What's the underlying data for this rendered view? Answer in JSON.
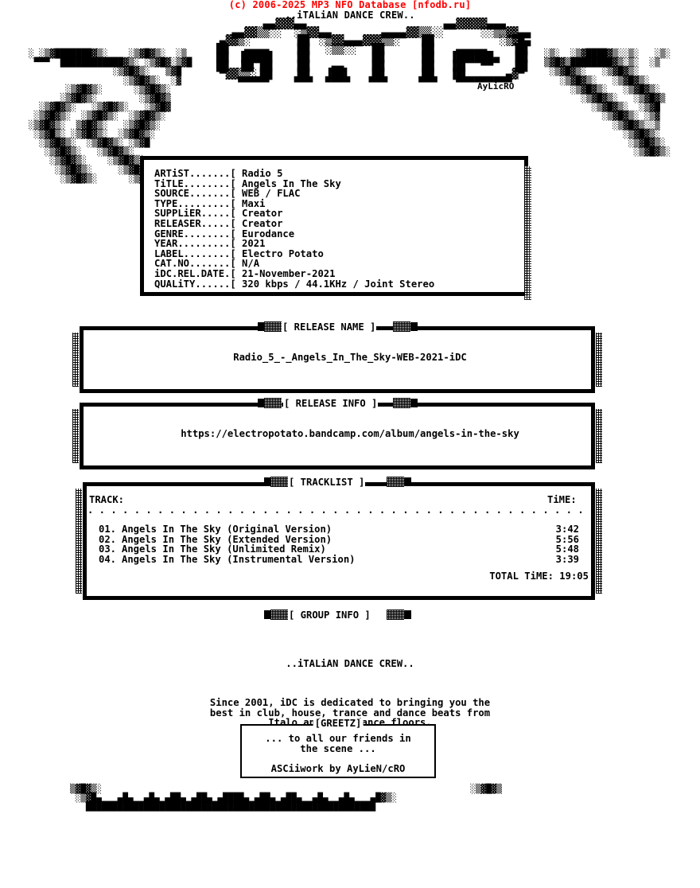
{
  "header": {
    "db_credit": "(c) 2006-2025 MP3 NFO Database [nfodb.ru]",
    "crew_tagline": "..iTALiAN DANCE CREW..",
    "credit_color": "#ff0000",
    "text_color": "#000000",
    "background_color": "#ffffff"
  },
  "logo": {
    "name": "idc-ascii-logo",
    "text": "iDC",
    "signature": "AyLicRO",
    "ascii": "        ▄▄▓▓▓▄▄                      ▄▄▓▓▓▓▓▄▄▄\n   ▄▄▓▓▒▒░░  ░▒▓▓▄▄        ▄▄▄▄▓▓▒▒░░      ░░▒▒▓▓▄▄\n ▄▓▓▒░       ▐█▌ ░▒▓▓▄▄▄▓▓▓▒▒░   ▐█▌          ░▒▓█▄\n▐█▌  ▄▄▄▄    ▐█▌  ░▒▒░░  ▐█▌     ▐█▌   ▄▄▄▄▄    ▐█▌\n▐█▌ ▐████▌   ▐█▌         ▐█▌     ▐█▌  ▐██████▄  ▐█▌\n▐█▌ ▐█▌▐█▌   ▐█▌   ▄▄    ▐█▌     ▐█▌  ▐█▌  ▀▀   ▐█▌\n ▀▓▓▒▒░▐█▌   ▐█▌  ▐██▌   ▐█▌     ▐█▌  ▐█▌      ▄▓▀\n    ▀▀▀▀▀    ▀▀▀  ▀▀▀▀   ▀▀▀     ▀▀▀   ▀▀▀▀▀▀▀▀▀"
  },
  "info": {
    "title": "release-info-box",
    "fields": [
      {
        "label": "ARTiST.......[",
        "value": "Radio 5"
      },
      {
        "label": "TiTLE........[",
        "value": "Angels In The Sky"
      },
      {
        "label": "SOURCE.......[",
        "value": "WEB / FLAC"
      },
      {
        "label": "TYPE.........[",
        "value": "Maxi"
      },
      {
        "label": "SUPPLiER.....[",
        "value": "Creator"
      },
      {
        "label": "RELEASER.....[",
        "value": "Creator"
      },
      {
        "label": "GENRE........[",
        "value": "Eurodance"
      },
      {
        "label": "YEAR.........[",
        "value": "2021"
      },
      {
        "label": "LABEL........[",
        "value": "Electro Potato"
      },
      {
        "label": "CAT.NO.......[",
        "value": "N/A"
      },
      {
        "label": "iDC.REL.DATE.[",
        "value": "21-November-2021"
      },
      {
        "label": "QUALiTY......[",
        "value": "320 kbps / 44.1KHz / Joint Stereo"
      }
    ],
    "block": "ARTiST.......[ Radio 5\nTiTLE........[ Angels In The Sky\nSOURCE.......[ WEB / FLAC\nTYPE.........[ Maxi\nSUPPLiER.....[ Creator\nRELEASER.....[ Creator\nGENRE........[ Eurodance\nYEAR.........[ 2021\nLABEL........[ Electro Potato\nCAT.NO.......[ N/A\niDC.REL.DATE.[ 21-November-2021\nQUALiTY......[ 320 kbps / 44.1KHz / Joint Stereo"
  },
  "sections": {
    "release_name": {
      "label": "[ RELEASE NAME ]",
      "value": "Radio_5_-_Angels_In_The_Sky-WEB-2021-iDC"
    },
    "release_info": {
      "label": "[ RELEASE INFO ]",
      "value": "https://electropotato.bandcamp.com/album/angels-in-the-sky"
    },
    "tracklist": {
      "label": "[ TRACKLIST ]",
      "col_track": "TRACK:",
      "col_time": "TiME:",
      "divider": ". . . . . . . . . . . . . . . . . . . . . . . . . . . . . . . . . . . . . . . . . . . . . . . .",
      "tracks": [
        {
          "num": "01.",
          "title": "Angels In The Sky (Original Version)",
          "time": "3:42"
        },
        {
          "num": "02.",
          "title": "Angels In The Sky (Extended Version)",
          "time": "5:56"
        },
        {
          "num": "03.",
          "title": "Angels In The Sky (Unlimited Remix)",
          "time": "5:48"
        },
        {
          "num": "04.",
          "title": "Angels In The Sky (Instrumental Version)",
          "time": "3:39"
        }
      ],
      "total_label": "TOTAL TiME:",
      "total_time": "19:05",
      "total_line": "TOTAL TiME: 19:05"
    },
    "group_info": {
      "label": "[ GROUP INFO ]",
      "heading": "..iTALiAN DANCE CREW..",
      "body": "Since 2001, iDC is dedicated to bringing you the\nbest in club, house, trance and dance beats from\nItalo and Euro dance floors."
    }
  },
  "greetz": {
    "title": "[GREETZ]",
    "lines": "... to all our friends in\nthe scene ...\n\nASCiiwork by AyLieN/cRO",
    "greeting": "... to all our friends in the scene ...",
    "ascii_credit": "ASCiiwork by AyLieN/cRO"
  },
  "decor": {
    "left_art": "░ ░▒▓███████▓▒░    ░▒▓█▓▒░  ░▒\n ▀▀▀  ████████████▓▒░ ░▒▓█▓░▒▓█\n                ░▒▓█▓▒░   ▒▓█\n                  ░▒▓█▓▒░  ░▓\n       ░▒▓█▓▒░      ░▒▓█▓▒░\n      ░▒▓█▓▒░        ░▒▓█▓▒\n  ░▒▓█▓▒░   ░▒▓█▓▒░   ░▒▓█▓\n ░▒▓█▓▒░  ░▒▓█▓▒░  ░▒▓█▓▒░\n░▒▓█▓▒░  ▒▓█▓▒░   ░▒▓█▓▒░\n ░▒▓█▒░ ░▒▓█▓▒░  ░▒▓█▓▒░\n  ░▒▓█▓▒░  ░▒▓█▓▒░ ░▒▓█\n   ░▒▓█▓▒░   ░▒▓█▓▒░\n    ░▒▓█▓▒░    ░▒▓█▓▒░\n     ░▒▓█▓▒░     ░▒▓█▓▒░\n      ░▒▓█▓▒░      ░▒▓█▓▒░",
    "right_art": "░▒░  ░▒▓████▓▒░░▒░   ░▒░\n▒▓█▓▒████████▓▒░▒░  ░▒\n ░▒▓█▓▒░   ░▒▓█▓▒░\n   ░▒▓█▓▒░   ░▒▓█▓▒░\n     ░▒▓█▓▒░   ░▒▓█▓▒░\n       ░▒▓█▓▒░   ░▒▓█▓▒\n         ░▒▓█▓▒░  ░▒▓█\n           ░▒▓█▓▒░ ░▒▓\n             ░▒▓█▓▒░░▒\n               ░▒▓█▓▒░\n                ░▒▓█▓▒░\n                 ░▒▓█▓▒░",
    "bottom_art": "▒▓█▓▒░                                                                      ░▒▓█▓▒\n ░▒▓█▄   ▄█▄  ▄█▄ ▄██▄ ▄██▄ ▄████▄ ▄██▄ ▄██▄  ▄█▄  ▄█▄   ▄█▓▒░\n   ███████████████████████████████████████████████████████"
  }
}
